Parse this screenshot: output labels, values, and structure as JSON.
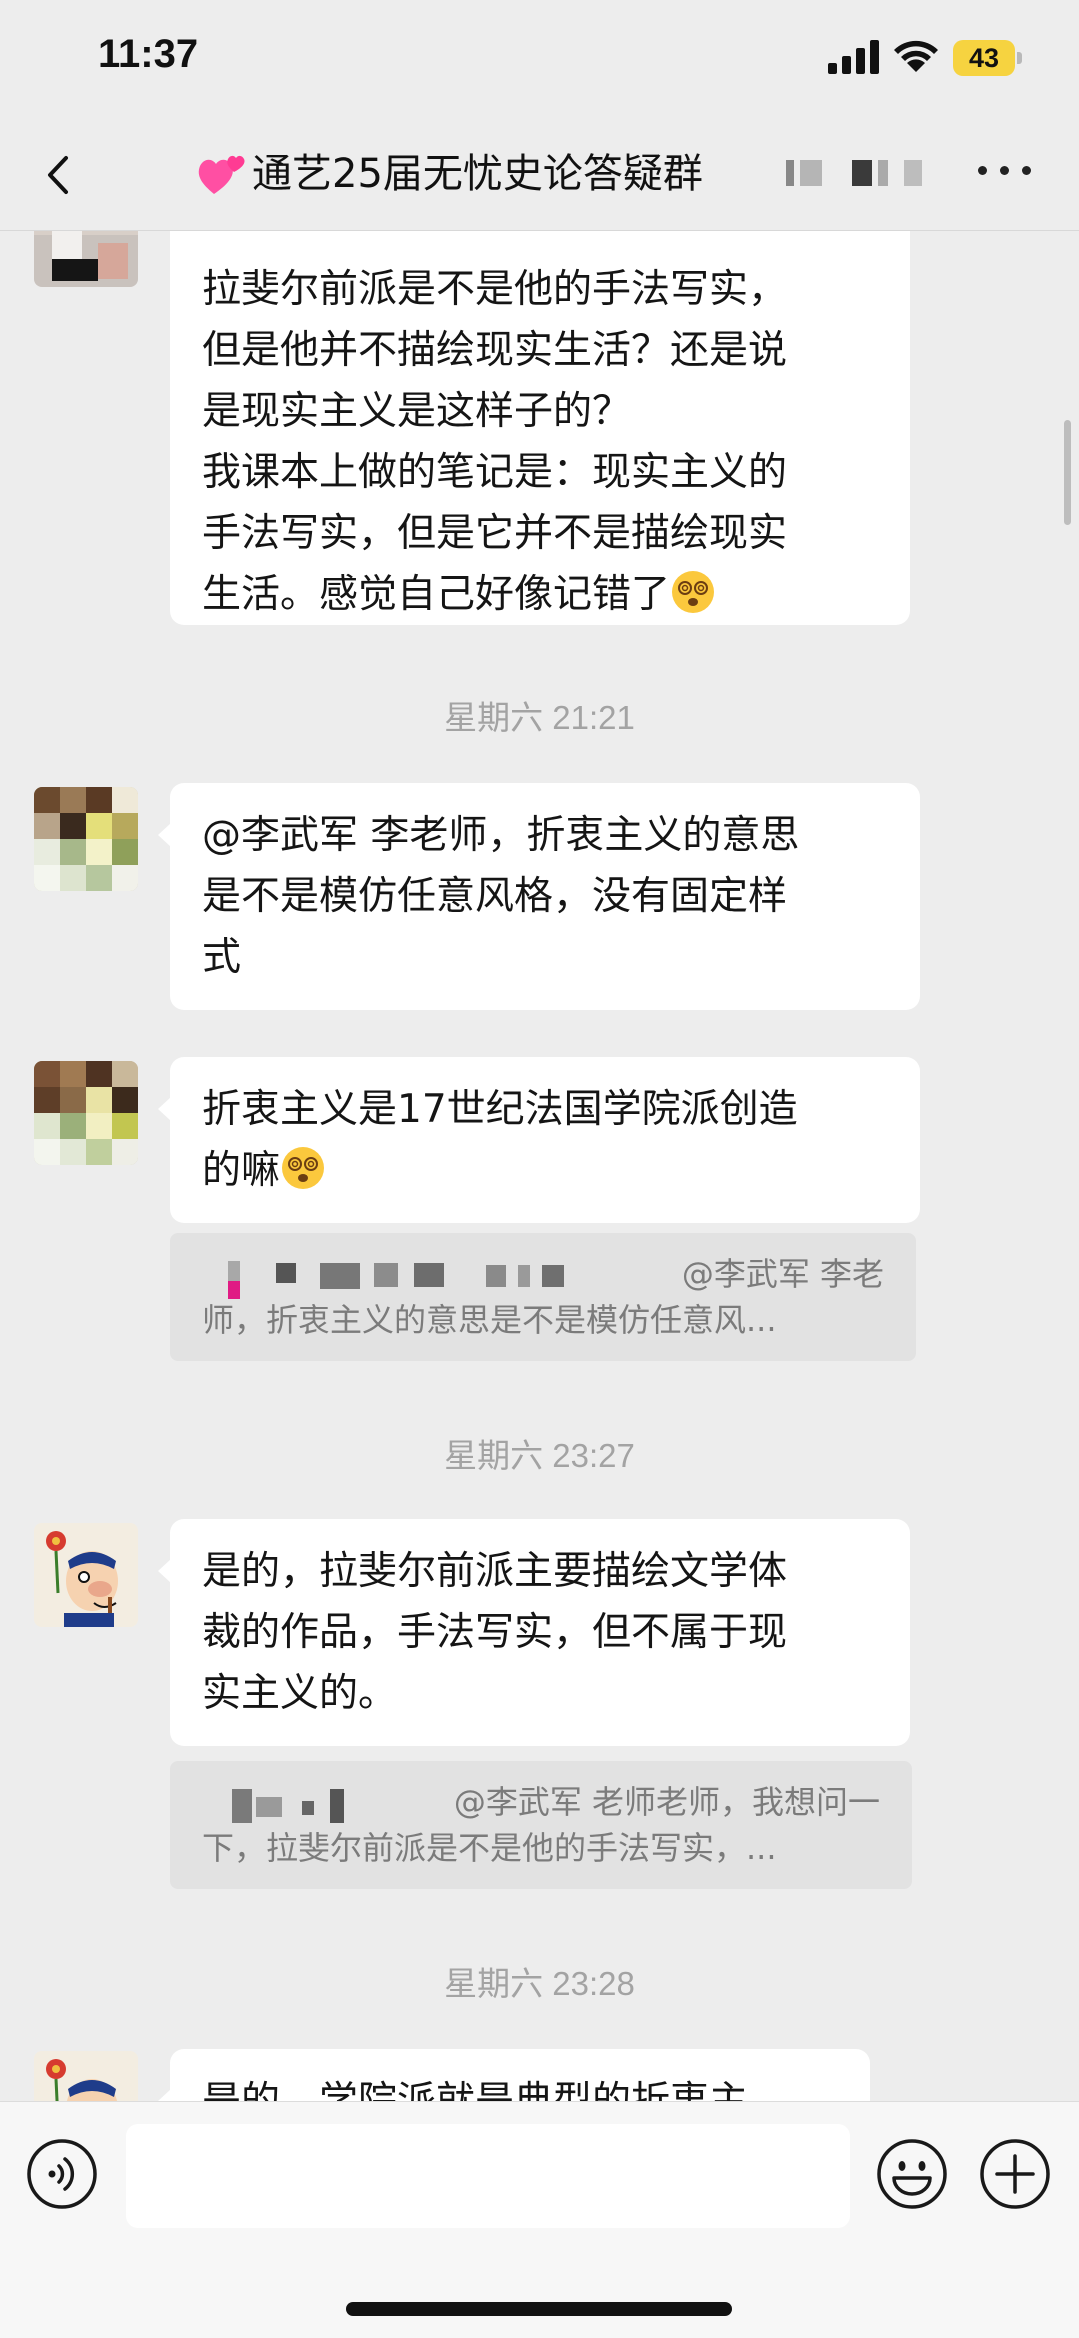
{
  "status_bar": {
    "time": "11:37",
    "battery": "43"
  },
  "nav": {
    "title": "通艺25届无忧史论答疑群",
    "back_icon": "chevron-left-icon",
    "more_icon": "more-dots-icon"
  },
  "messages": {
    "m1": {
      "lines": [
        "拉斐尔前派是不是他的手法写实，",
        "但是他并不描绘现实生活？还是说",
        "是现实主义是这样子的？",
        "我课本上做的笔记是：现实主义的",
        "手法写实，但是它并不是描绘现实"
      ],
      "last_line": "生活。感觉自己好像记错了"
    },
    "ts1": "星期六 21:21",
    "m2": {
      "lines": [
        "@李武军 李老师，折衷主义的意思",
        "是不是模仿任意风格，没有固定样",
        "式"
      ]
    },
    "m3": {
      "lines": [
        "折衷主义是17世纪法国学院派创造"
      ],
      "last_line": "的嘛"
    },
    "q3": {
      "line1": "@李武军 李老",
      "line2": "师，折衷主义的意思是不是模仿任意风..."
    },
    "ts2": "星期六 23:27",
    "m4": {
      "lines": [
        "是的，拉斐尔前派主要描绘文学体",
        "裁的作品，手法写实，但不属于现",
        "实主义的。"
      ]
    },
    "q4": {
      "line1": "@李武军 老师老师，我想问一",
      "line2": "下，拉斐尔前派是不是他的手法写实，..."
    },
    "ts3": "星期六 23:28",
    "m5": {
      "lines": [
        "是的，学院派就是典型的折衷主"
      ]
    }
  },
  "input": {
    "value": "",
    "placeholder": ""
  },
  "icons": {
    "voice": "voice-icon",
    "emoji": "emoji-icon",
    "plus": "plus-icon"
  },
  "colors": {
    "background": "#ededed",
    "bubble": "#ffffff",
    "quote": "#e2e2e2",
    "timestamp": "#a3a3a3",
    "battery": "#f6d340"
  }
}
